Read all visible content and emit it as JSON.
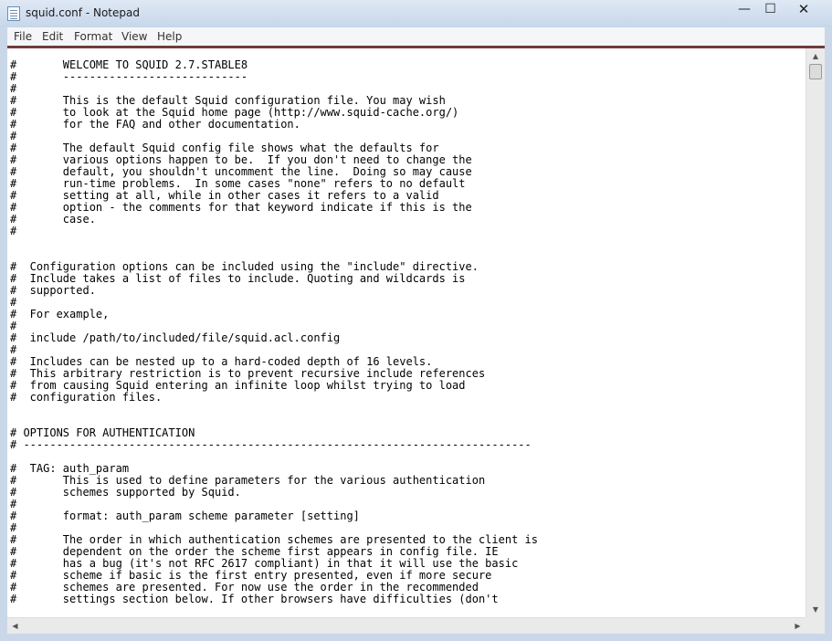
{
  "window": {
    "title": "squid.conf - Notepad",
    "controls": {
      "minimize": "—",
      "maximize": "☐",
      "close": "✕"
    }
  },
  "menu": {
    "file": "File",
    "edit": "Edit",
    "format": "Format",
    "view": "View",
    "help": "Help"
  },
  "scrollbars": {
    "up": "▲",
    "down": "▼",
    "left": "◀",
    "right": "▶"
  },
  "editor": {
    "content": "#\tWELCOME TO SQUID 2.7.STABLE8\n#\t----------------------------\n#\n#\tThis is the default Squid configuration file. You may wish\n#\tto look at the Squid home page (http://www.squid-cache.org/)\n#\tfor the FAQ and other documentation.\n#\n#\tThe default Squid config file shows what the defaults for\n#\tvarious options happen to be.  If you don't need to change the\n#\tdefault, you shouldn't uncomment the line.  Doing so may cause\n#\trun-time problems.  In some cases \"none\" refers to no default\n#\tsetting at all, while in other cases it refers to a valid\n#\toption - the comments for that keyword indicate if this is the\n#\tcase.\n#\n\n\n#  Configuration options can be included using the \"include\" directive.\n#  Include takes a list of files to include. Quoting and wildcards is\n#  supported.\n#\n#  For example,\n#\n#  include /path/to/included/file/squid.acl.config\n#\n#  Includes can be nested up to a hard-coded depth of 16 levels.\n#  This arbitrary restriction is to prevent recursive include references\n#  from causing Squid entering an infinite loop whilst trying to load\n#  configuration files.\n\n\n# OPTIONS FOR AUTHENTICATION\n# -----------------------------------------------------------------------------\n\n#  TAG: auth_param\n#\tThis is used to define parameters for the various authentication\n#\tschemes supported by Squid.\n#\n#\tformat: auth_param scheme parameter [setting]\n#\n#\tThe order in which authentication schemes are presented to the client is\n#\tdependent on the order the scheme first appears in config file. IE\n#\thas a bug (it's not RFC 2617 compliant) in that it will use the basic\n#\tscheme if basic is the first entry presented, even if more secure\n#\tschemes are presented. For now use the order in the recommended\n#\tsettings section below. If other browsers have difficulties (don't"
  }
}
